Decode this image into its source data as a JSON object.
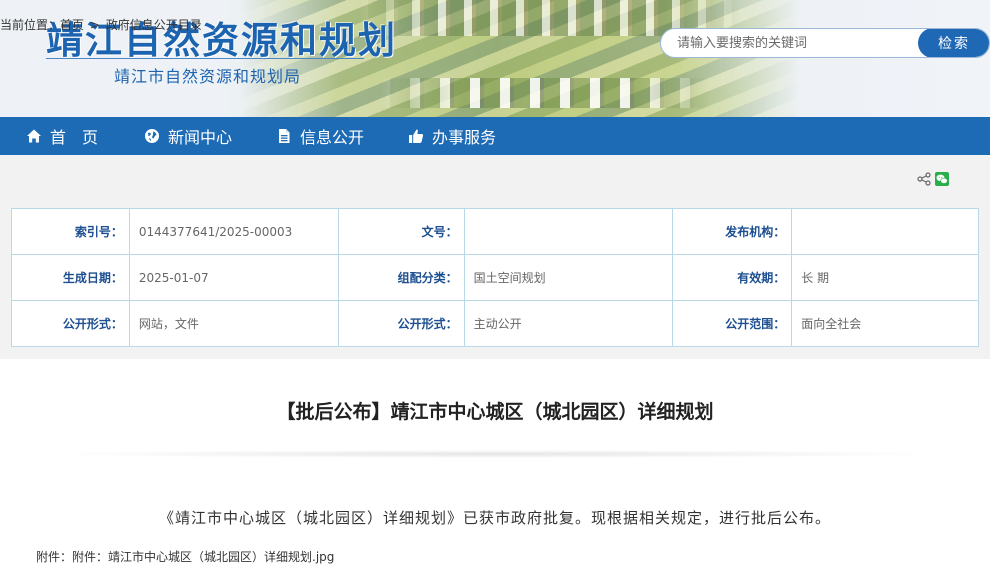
{
  "header": {
    "site_title": "靖江自然资源和规划",
    "site_subtitle": "靖江市自然资源和规划局",
    "search_placeholder": "请输入要搜索的关键词",
    "search_button": "检索"
  },
  "nav": {
    "items": [
      {
        "label": "首　页",
        "icon": "home-icon"
      },
      {
        "label": "新闻中心",
        "icon": "globe-icon"
      },
      {
        "label": "信息公开",
        "icon": "document-icon"
      },
      {
        "label": "办事服务",
        "icon": "thumbs-up-icon"
      }
    ]
  },
  "breadcrumb": {
    "prefix": "当前位置：",
    "home": "首页",
    "separator": ">",
    "current": "政府信息公开目录"
  },
  "share": {
    "icons": [
      "share-icon",
      "wechat-icon"
    ]
  },
  "meta": {
    "rows": [
      [
        {
          "key": "索引号：",
          "value": "0144377641/2025-00003"
        },
        {
          "key": "文号：",
          "value": ""
        },
        {
          "key": "发布机构：",
          "value": ""
        }
      ],
      [
        {
          "key": "生成日期：",
          "value": "2025-01-07"
        },
        {
          "key": "组配分类：",
          "value": "国土空间规划"
        },
        {
          "key": "有效期：",
          "value": "长 期"
        }
      ],
      [
        {
          "key": "公开形式：",
          "value": "网站，文件"
        },
        {
          "key": "公开形式：",
          "value": "主动公开"
        },
        {
          "key": "公开范围：",
          "value": "面向全社会"
        }
      ]
    ]
  },
  "article": {
    "title": "【批后公布】靖江市中心城区（城北园区）详细规划",
    "body": "《靖江市中心城区（城北园区）详细规划》已获市政府批复。现根据相关规定，进行批后公布。",
    "attachment_prefix": "附件：附件：",
    "attachment_name": "靖江市中心城区（城北园区）详细规划.jpg"
  },
  "colors": {
    "primary": "#1d6ab5",
    "title_blue": "#1c63b0",
    "table_border": "#b9d8e8",
    "wechat_green": "#2aae4a"
  }
}
